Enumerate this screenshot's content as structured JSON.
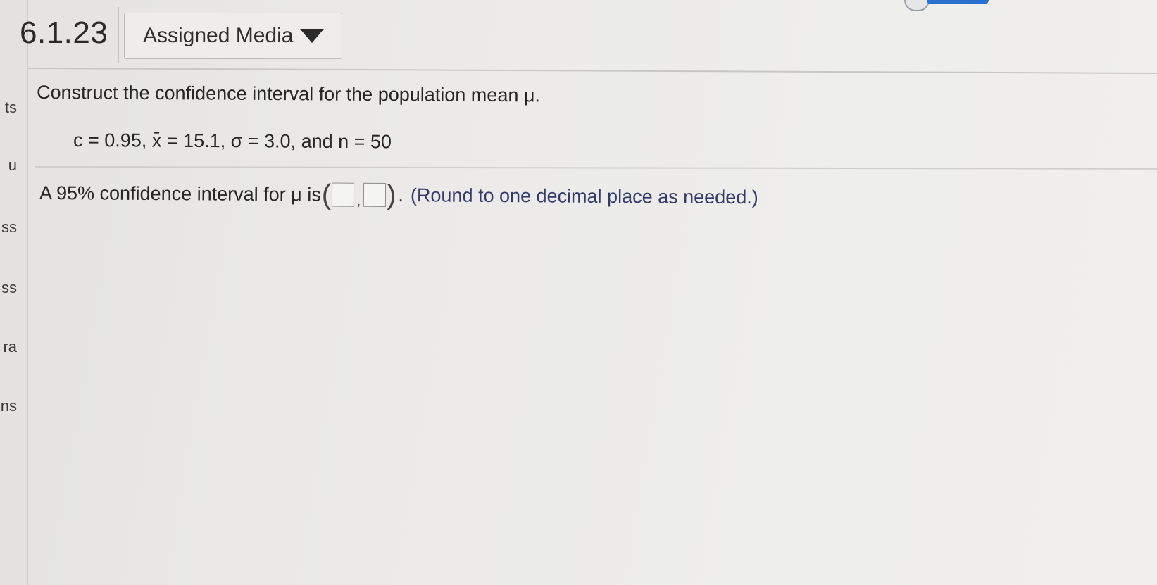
{
  "sidebar": {
    "fragments": [
      "ts",
      "u",
      "ss",
      "ss",
      "ra",
      "ons"
    ]
  },
  "header": {
    "question_number": "6.1.23",
    "media_button_label": "Assigned Media"
  },
  "question": {
    "prompt": "Construct the confidence interval for the population mean μ.",
    "given_c": "c = 0.95, ",
    "given_x_symbol": "x",
    "given_rest": " = 15.1, σ = 3.0, and n = 50",
    "answer_lead": "A 95% confidence interval for μ is ",
    "paren_open": "(",
    "comma": ",",
    "paren_close": ")",
    "period": ".",
    "instruction": "(Round to one decimal place as needed.)"
  },
  "answers": {
    "lower_value": "",
    "upper_value": ""
  },
  "colors": {
    "instruction_text": "#343a6a",
    "top_button": "#2b6fcf"
  }
}
